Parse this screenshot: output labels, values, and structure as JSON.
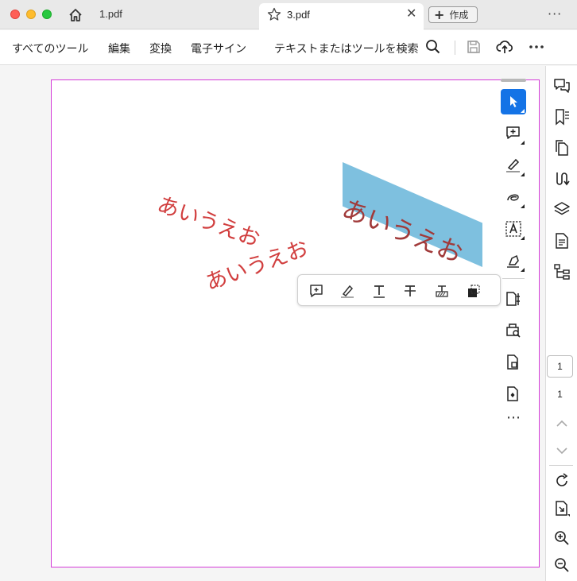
{
  "tabs": [
    {
      "label": "1.pdf",
      "active": false
    },
    {
      "label": "3.pdf",
      "active": true
    }
  ],
  "tabbar": {
    "new_label": "作成",
    "close_glyph": "✕",
    "more_glyph": "···"
  },
  "toolbar": {
    "all_tools": "すべてのツール",
    "edit": "編集",
    "convert": "変換",
    "esign": "電子サイン",
    "search_label": "テキストまたはツールを検索"
  },
  "document": {
    "texts": [
      "あいうえお",
      "あいうえお",
      "あいうえお"
    ]
  },
  "page_nav": {
    "current": "1",
    "total": "1"
  },
  "tools_more": "⋯",
  "colors": {
    "accent": "#1473e6",
    "annotation_red": "#d13e3e",
    "selection": "#7ec0df",
    "page_border": "#d43bd8"
  }
}
